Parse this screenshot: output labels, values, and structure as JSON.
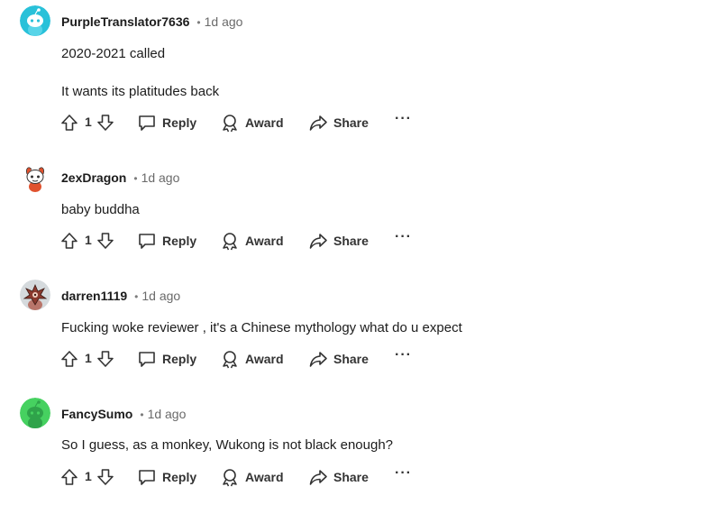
{
  "comments": [
    {
      "author": "PurpleTranslator7636",
      "time": "1d ago",
      "lines": [
        "2020-2021 called",
        "It wants its platitudes back"
      ],
      "votes": "1",
      "avatar_color": "#29c1d9"
    },
    {
      "author": "2exDragon",
      "time": "1d ago",
      "lines": [
        "baby buddha"
      ],
      "votes": "1",
      "avatar_color": "#ffffff"
    },
    {
      "author": "darren1119",
      "time": "1d ago",
      "lines": [
        "Fucking woke reviewer , it's a Chinese mythology what do u expect"
      ],
      "votes": "1",
      "avatar_color": "#d5dadd"
    },
    {
      "author": "FancySumo",
      "time": "1d ago",
      "lines": [
        "So I guess, as a monkey, Wukong is not black enough?"
      ],
      "votes": "1",
      "avatar_color": "#46d160"
    }
  ],
  "actions": {
    "reply": "Reply",
    "award": "Award",
    "share": "Share",
    "more": "···"
  },
  "separator": "•"
}
